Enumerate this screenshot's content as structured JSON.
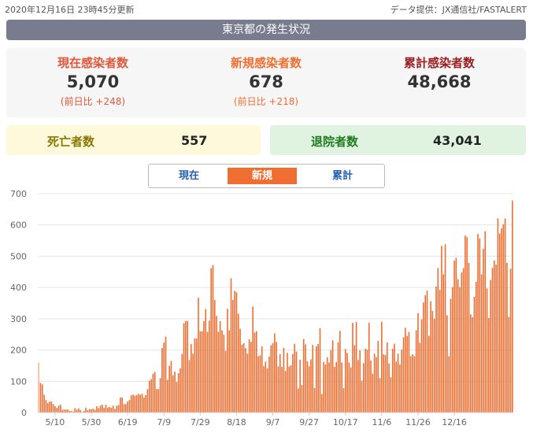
{
  "top": {
    "updated": "2020年12月16日 23時45分更新",
    "source": "データ提供：JX通信社/FASTALERT"
  },
  "header": {
    "title": "東京都の発生状況"
  },
  "stats": {
    "current": {
      "label": "現在感染者数",
      "value": "5,070",
      "diff": "(前日比 +248)",
      "color": "#e2563a"
    },
    "new": {
      "label": "新規感染者数",
      "value": "678",
      "diff": "(前日比 +218)",
      "color": "#ef6f32"
    },
    "total": {
      "label": "累計感染者数",
      "value": "48,668",
      "color": "#9c1d1d"
    }
  },
  "deaths": {
    "label": "死亡者数",
    "value": "557"
  },
  "recovered": {
    "label": "退院者数",
    "value": "43,041"
  },
  "tabs": {
    "current": "現在",
    "new": "新規",
    "total": "累計",
    "active": "new"
  },
  "chart_data": {
    "type": "bar",
    "title": "",
    "xlabel": "",
    "ylabel": "",
    "ylim": [
      0,
      700
    ],
    "yticks": [
      0,
      100,
      200,
      300,
      400,
      500,
      600,
      700
    ],
    "color": "#ef6f32",
    "grid": true,
    "start_date": "2020-05-01",
    "end_date": "2020-12-16",
    "xtick_labels": [
      "5/10",
      "5/30",
      "6/19",
      "7/9",
      "7/29",
      "8/18",
      "9/7",
      "9/27",
      "10/17",
      "11/6",
      "11/26",
      "12/16"
    ],
    "values": [
      160,
      95,
      90,
      57,
      40,
      30,
      35,
      35,
      27,
      20,
      15,
      22,
      25,
      8,
      10,
      9,
      10,
      5,
      5,
      3,
      14,
      9,
      13,
      8,
      2,
      5,
      15,
      8,
      11,
      10,
      12,
      9,
      20,
      14,
      22,
      25,
      15,
      25,
      16,
      18,
      15,
      22,
      11,
      22,
      24,
      48,
      48,
      27,
      27,
      35,
      41,
      55,
      57,
      54,
      56,
      60,
      57,
      60,
      48,
      56,
      75,
      102,
      107,
      124,
      130,
      75,
      75,
      110,
      206,
      224,
      243,
      104,
      149,
      165,
      119,
      131,
      98,
      126,
      141,
      187,
      286,
      293,
      293,
      168,
      219,
      188,
      237,
      237,
      367,
      260,
      260,
      292,
      331,
      258,
      294,
      462,
      472,
      360,
      309,
      258,
      292,
      263,
      249,
      197,
      332,
      263,
      429,
      360,
      389,
      385,
      316,
      268,
      217,
      222,
      206,
      188,
      234,
      226,
      339,
      256,
      260,
      180,
      183,
      212,
      148,
      163,
      141,
      179,
      215,
      222,
      253,
      226,
      147,
      187,
      146,
      207,
      133,
      191,
      147,
      151,
      187,
      220,
      195,
      77,
      169,
      88,
      235,
      218,
      164,
      148,
      170,
      216,
      78,
      212,
      219,
      270,
      59,
      162,
      154,
      177,
      160,
      200,
      231,
      146,
      161,
      225,
      261,
      160,
      78,
      203,
      190,
      160,
      144,
      287,
      215,
      290,
      168,
      199,
      102,
      158,
      204,
      201,
      287,
      166,
      124,
      188,
      177,
      229,
      110,
      290,
      186,
      184,
      224,
      157,
      113,
      204,
      220,
      163,
      188,
      154,
      201,
      241,
      271,
      245,
      258,
      180,
      186,
      180,
      263,
      318,
      223,
      298,
      352,
      375,
      390,
      245,
      356,
      325,
      300,
      403,
      462,
      392,
      533,
      442,
      538,
      311,
      180,
      364,
      401,
      486,
      495,
      426,
      401,
      448,
      462,
      566,
      561,
      479,
      314,
      305,
      370,
      418,
      571,
      557,
      442,
      524,
      580,
      397,
      302,
      424,
      463,
      486,
      473,
      621,
      572,
      589,
      602,
      621,
      479,
      305,
      460,
      678
    ]
  }
}
